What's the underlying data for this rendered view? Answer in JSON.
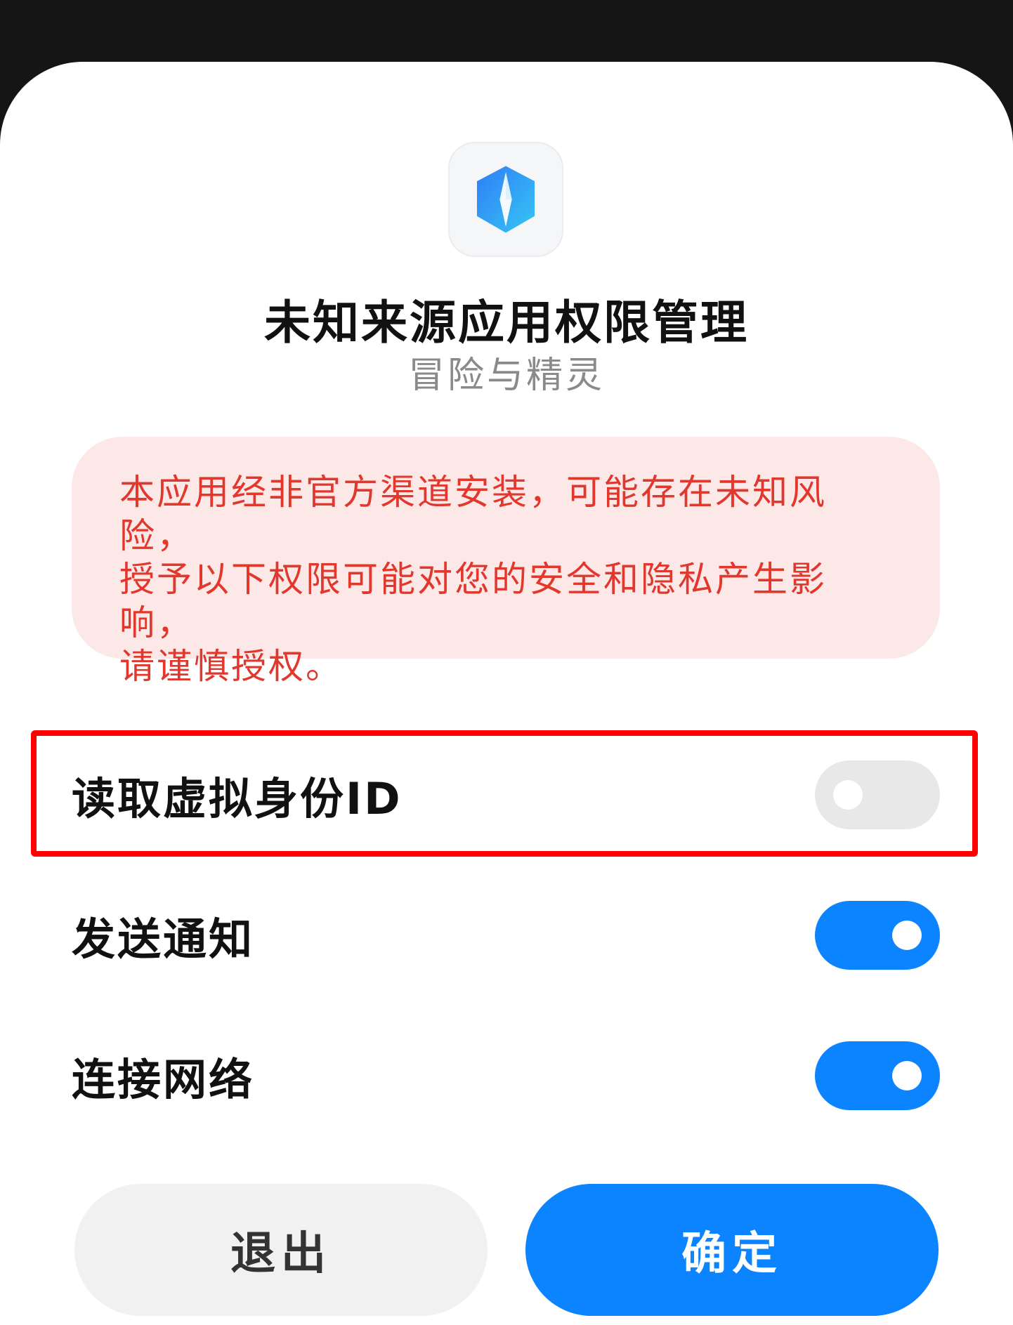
{
  "dialog": {
    "title": "未知来源应用权限管理",
    "app_name": "冒险与精灵",
    "app_icon": "shield-compass-icon",
    "warning_lines": [
      "本应用经非官方渠道安装，可能存在未知风险，",
      "授予以下权限可能对您的安全和隐私产生影响，",
      "请谨慎授权。"
    ]
  },
  "permissions": [
    {
      "label": "读取虚拟身份ID",
      "enabled": false
    },
    {
      "label": "发送通知",
      "enabled": true
    },
    {
      "label": "连接网络",
      "enabled": true
    }
  ],
  "buttons": {
    "exit_label": "退出",
    "confirm_label": "确定"
  },
  "colors": {
    "accent": "#0d84ff",
    "warning_text": "#e2372d",
    "warning_bg": "#fde8e8",
    "highlight": "#ff0000"
  }
}
